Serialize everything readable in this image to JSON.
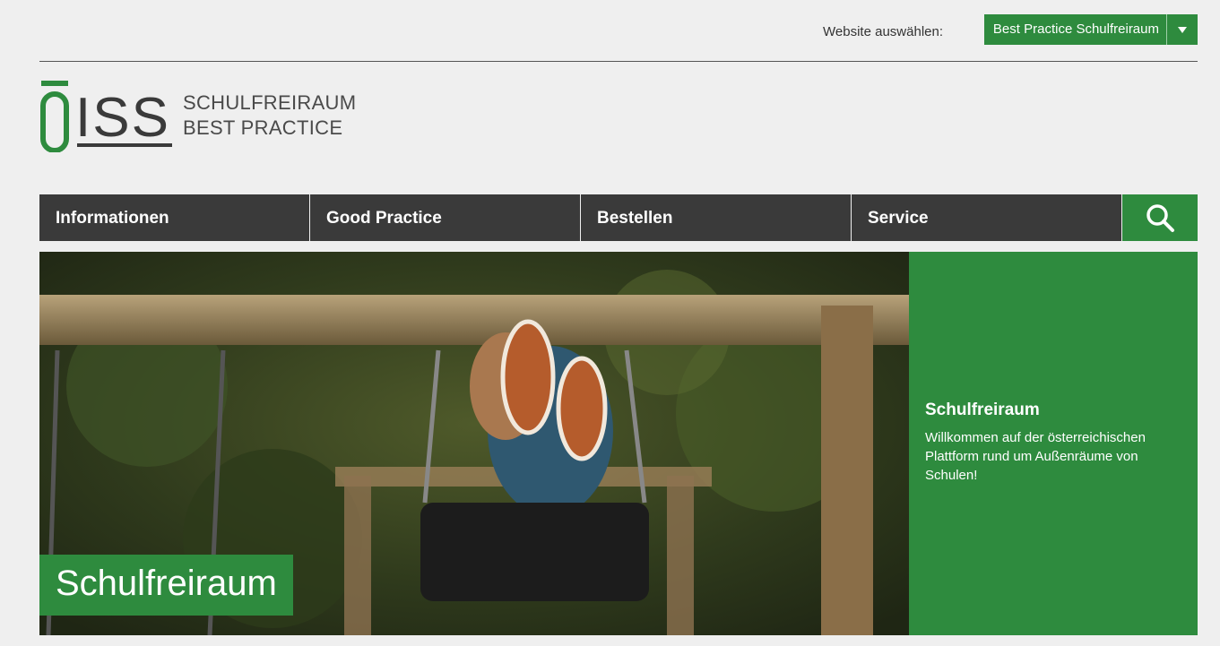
{
  "header": {
    "site_label": "Website auswählen:",
    "site_select_value": "Best Practice Schulfreiraum"
  },
  "logo": {
    "mark": "ÖISS",
    "line1": "SCHULFREIRAUM",
    "line2": "BEST PRACTICE"
  },
  "nav": {
    "items": [
      {
        "label": "Informationen"
      },
      {
        "label": "Good Practice"
      },
      {
        "label": "Bestellen"
      },
      {
        "label": "Service"
      }
    ],
    "search_icon": "search-icon"
  },
  "hero": {
    "title": "Schulfreiraum",
    "image": "child-on-swing-photo"
  },
  "panel": {
    "title": "Schulfreiraum",
    "text": "Willkommen auf der österreichischen Plattform rund um Außenräume von Schulen!"
  },
  "colors": {
    "brand_green": "#2e8b3e",
    "nav_dark": "#3a3a3a",
    "background": "#efefef"
  }
}
